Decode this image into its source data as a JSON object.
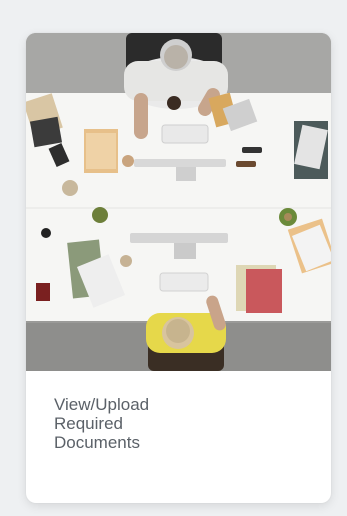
{
  "card": {
    "title_lines": [
      "View/Upload",
      "Required",
      "Documents"
    ]
  },
  "image": {
    "icon": "office-desk-photo"
  }
}
